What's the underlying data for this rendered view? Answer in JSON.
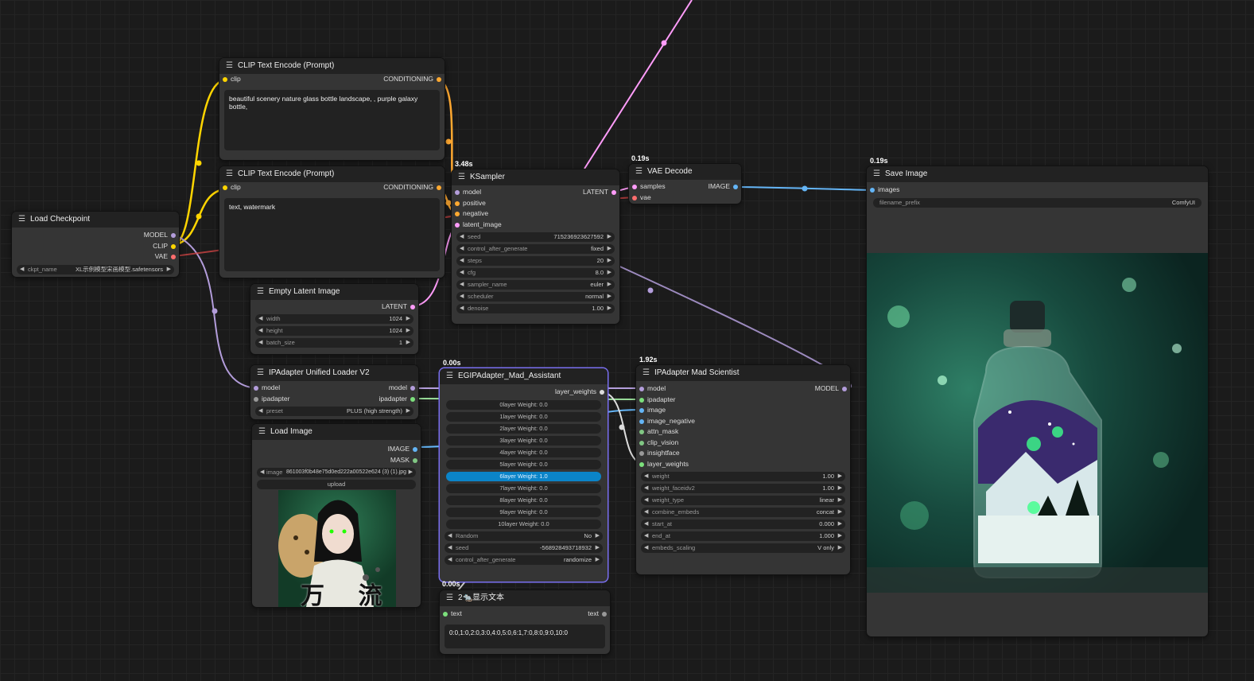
{
  "colors": {
    "model": "#b39ddb",
    "clip": "#ffd500",
    "vae": "#ff6e6e",
    "conditioning": "#ffa931",
    "latent": "#ff9cf9",
    "image": "#64b5f6",
    "selected": "#7a6ff0",
    "highlight": "#0b84c8"
  },
  "clip1": {
    "title": "CLIP Text Encode (Prompt)",
    "in": "clip",
    "out": "CONDITIONING",
    "text": "beautiful scenery nature glass bottle landscape, , purple galaxy bottle,"
  },
  "clip2": {
    "title": "CLIP Text Encode (Prompt)",
    "in": "clip",
    "out": "CONDITIONING",
    "text": "text, watermark"
  },
  "ckpt": {
    "title": "Load Checkpoint",
    "outs": [
      "MODEL",
      "CLIP",
      "VAE"
    ],
    "w_label": "ckpt_name",
    "w_value": "XL示例模型宋画模型.safetensors"
  },
  "latent": {
    "title": "Empty Latent Image",
    "out": "LATENT",
    "widgets": [
      {
        "label": "width",
        "value": "1024"
      },
      {
        "label": "height",
        "value": "1024"
      },
      {
        "label": "batch_size",
        "value": "1"
      }
    ]
  },
  "ksampler": {
    "timing": "3.48s",
    "title": "KSampler",
    "ins": [
      "model",
      "positive",
      "negative",
      "latent_image"
    ],
    "out": "LATENT",
    "widgets": [
      {
        "label": "seed",
        "value": "715236923627592"
      },
      {
        "label": "control_after_generate",
        "value": "fixed"
      },
      {
        "label": "steps",
        "value": "20"
      },
      {
        "label": "cfg",
        "value": "8.0"
      },
      {
        "label": "sampler_name",
        "value": "euler"
      },
      {
        "label": "scheduler",
        "value": "normal"
      },
      {
        "label": "denoise",
        "value": "1.00"
      }
    ]
  },
  "vaedec": {
    "timing": "0.19s",
    "title": "VAE Decode",
    "ins": [
      "samples",
      "vae"
    ],
    "out": "IMAGE"
  },
  "save": {
    "timing": "0.19s",
    "title": "Save Image",
    "in": "images",
    "w_label": "filename_prefix",
    "w_value": "ComfyUI",
    "image_desc": "glass bottle with galaxy landscape"
  },
  "ipload": {
    "title": "IPAdapter Unified Loader V2",
    "rows": [
      {
        "in": "model",
        "out": "model"
      },
      {
        "in": "ipadapter",
        "out": "ipadapter"
      }
    ],
    "w_label": "preset",
    "w_value": "PLUS (high strength)"
  },
  "loadimg": {
    "title": "Load Image",
    "outs": [
      "IMAGE",
      "MASK"
    ],
    "w_label": "image",
    "w_value": "861003f0b48e75d0ed222a00522e624 (3) (1).jpg",
    "upload": "upload",
    "preview_text": "万 流"
  },
  "egip": {
    "timing": "0.00s",
    "title": "EGIPAdapter_Mad_Assistant",
    "out": "layer_weights",
    "layers": [
      "0layer Weight: 0.0",
      "1layer Weight: 0.0",
      "2layer Weight: 0.0",
      "3layer Weight: 0.0",
      "4layer Weight: 0.0",
      "5layer Weight: 0.0",
      "6layer Weight: 1.0",
      "7layer Weight: 0.0",
      "8layer Weight: 0.0",
      "9layer Weight: 0.0",
      "10layer Weight: 0.0"
    ],
    "highlighted_layer": "6layer Weight: 1.0",
    "widgets": [
      {
        "label": "Random",
        "value": "No"
      },
      {
        "label": "seed",
        "value": "-568928493718932"
      },
      {
        "label": "control_after_generate",
        "value": "randomize"
      }
    ]
  },
  "ipmad": {
    "timing": "1.92s",
    "title": "IPAdapter Mad Scientist",
    "ins": [
      "model",
      "ipadapter",
      "image",
      "image_negative",
      "attn_mask",
      "clip_vision",
      "insightface",
      "layer_weights"
    ],
    "out": "MODEL",
    "widgets": [
      {
        "label": "weight",
        "value": "1.00"
      },
      {
        "label": "weight_faceidv2",
        "value": "1.00"
      },
      {
        "label": "weight_type",
        "value": "linear"
      },
      {
        "label": "combine_embeds",
        "value": "concat"
      },
      {
        "label": "start_at",
        "value": "0.000"
      },
      {
        "label": "end_at",
        "value": "1.000"
      },
      {
        "label": "embeds_scaling",
        "value": "V only"
      }
    ]
  },
  "show": {
    "timing": "0.00s",
    "title": "2🐀显示文本",
    "in": "text",
    "out": "text",
    "value": "0:0,1:0,2:0,3:0,4:0,5:0,6:1,7:0,8:0,9:0,10:0"
  }
}
